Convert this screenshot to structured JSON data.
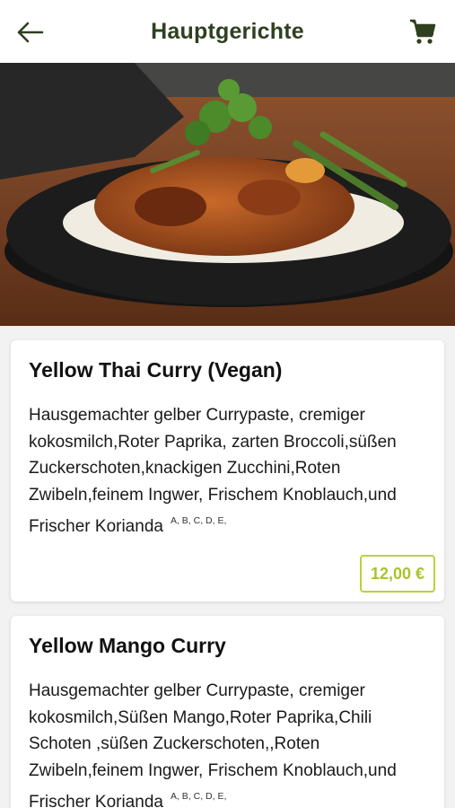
{
  "header": {
    "title": "Hauptgerichte",
    "back_icon": "arrow-left-icon",
    "cart_icon": "shopping-cart-icon"
  },
  "colors": {
    "title": "#2e4020",
    "price_accent": "#b8d23a",
    "background": "#f2f2f2"
  },
  "items": [
    {
      "title": "Yellow Thai Curry (Vegan)",
      "description": "Hausgemachter gelber Currypaste, cremiger kokosmilch,Roter Paprika, zarten Broccoli,süßen Zuckerschoten,knackigen Zucchini,Roten Zwibeln,feinem Ingwer, Frischem Knoblauch,und Frischer Korianda",
      "allergens": "A, B, C, D, E,",
      "price": "12,00 €"
    },
    {
      "title": "Yellow Mango Curry",
      "description": "Hausgemachter gelber Currypaste, cremiger kokosmilch,Süßen Mango,Roter Paprika,Chili Schoten ,süßen Zuckerschoten,,Roten Zwibeln,feinem Ingwer, Frischem Knoblauch,und Frischer Korianda",
      "allergens": "A, B, C, D, E,"
    }
  ]
}
